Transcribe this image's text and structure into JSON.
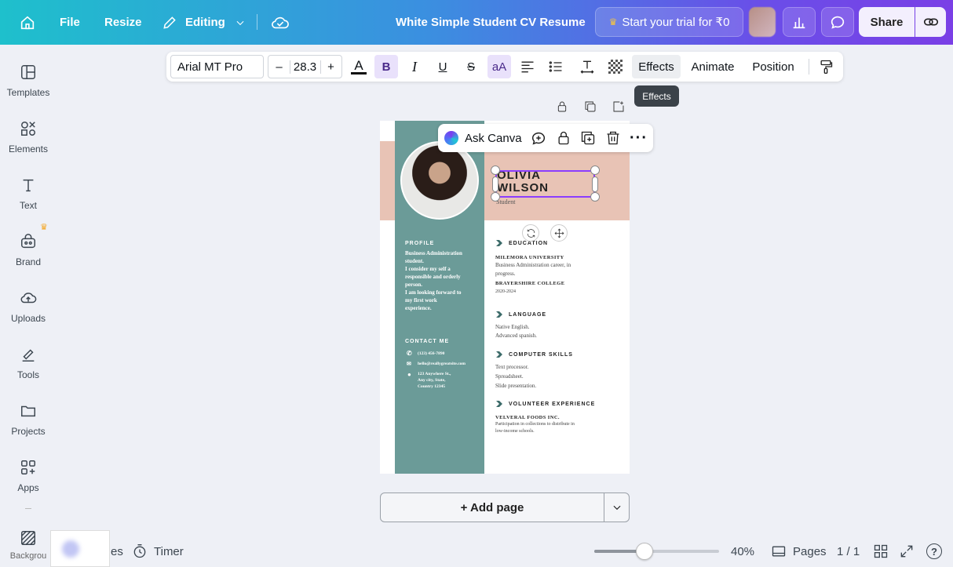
{
  "topbar": {
    "file": "File",
    "resize": "Resize",
    "editing": "Editing",
    "title": "White Simple Student CV Resume",
    "trial": "Start your trial for ₹0",
    "share": "Share"
  },
  "sidebar": {
    "items": [
      {
        "label": "Templates",
        "icon": "templates-icon"
      },
      {
        "label": "Elements",
        "icon": "elements-icon"
      },
      {
        "label": "Text",
        "icon": "text-icon"
      },
      {
        "label": "Brand",
        "icon": "brand-icon"
      },
      {
        "label": "Uploads",
        "icon": "uploads-icon"
      },
      {
        "label": "Tools",
        "icon": "tools-icon"
      },
      {
        "label": "Projects",
        "icon": "projects-icon"
      },
      {
        "label": "Apps",
        "icon": "apps-icon"
      },
      {
        "label": "Backgrou",
        "icon": "background-icon"
      }
    ]
  },
  "toolbar": {
    "font": "Arial MT Pro",
    "font_size": "28.3",
    "minus": "–",
    "plus": "+",
    "effects": "Effects",
    "animate": "Animate",
    "position": "Position",
    "tooltip": "Effects",
    "bold": "B",
    "italic": "I",
    "underline": "U",
    "strike": "S",
    "case": "aA",
    "text_color": "A"
  },
  "ask": {
    "label": "Ask Canva"
  },
  "resume": {
    "name_line1": "OLIVIA",
    "name_line2": "WILSON",
    "role": "Student",
    "profile_h": "PROFILE",
    "profile_lines": [
      "Business Administration",
      "student.",
      "I consider my self a",
      "responsible and orderly",
      "person.",
      "I am looking forward to",
      "my first work",
      "experience."
    ],
    "contact_h": "CONTACT ME",
    "phone": "(123) 456-7890",
    "email": "hello@reallygreatsite.com",
    "address1": "123 Anywhere St.,",
    "address2": "Any city, State,",
    "address3": "Country 12345",
    "education_h": "EDUCATION",
    "edu1": "MILEMORA UNIVERSITY",
    "edu1_d1": "Business Administration career, in",
    "edu1_d2": "progress.",
    "edu2": "BRAYERSHIRE COLLEGE",
    "edu2_d": "2020-2024",
    "language_h": "LANGUAGE",
    "lang1": "Native English.",
    "lang2": "Advanced spanish.",
    "skills_h": "COMPUTER SKILLS",
    "skill1": "Text processor.",
    "skill2": "Spreadsheet.",
    "skill3": "Slide presentation.",
    "vol_h": "VOLUNTEER EXPERIENCE",
    "vol1": "VELVERAL FOODS INC.",
    "vol1_d1": "Participation in collections to distribute in",
    "vol1_d2": "low-income schools."
  },
  "add_page": "+ Add page",
  "bottom": {
    "notes": "es",
    "timer": "Timer",
    "zoom": "40%",
    "zoom_level": 0.4,
    "pages": "Pages",
    "page_count": "1 / 1",
    "help": "?"
  },
  "colors": {
    "accent": "#8b3dff",
    "teal": "#6b9b98",
    "peach": "#e8c3b5"
  }
}
